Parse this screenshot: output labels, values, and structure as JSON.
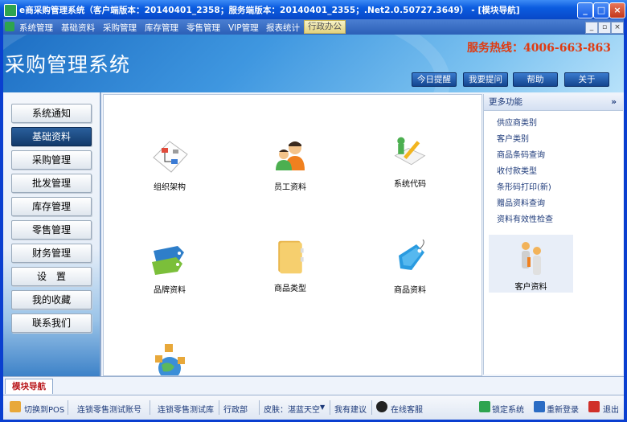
{
  "window": {
    "title": "e商采购管理系统（客户端版本：20140401_2358；服务端版本：20140401_2355；.Net2.0.50727.3649） - [模块导航]",
    "minimize": "_",
    "maximize": "□",
    "close": "×"
  },
  "menu": {
    "items": [
      "系统管理",
      "基础资料",
      "采购管理",
      "库存管理",
      "零售管理",
      "VIP管理",
      "报表统计",
      "行政办公"
    ],
    "mdi_minimize": "_",
    "mdi_restore": "▫",
    "mdi_close": "×"
  },
  "header": {
    "app_name": "采购管理系统",
    "hotline": "服务热线：4006-663-863",
    "buttons": [
      "今日提醒",
      "我要提问",
      "帮助",
      "关于"
    ]
  },
  "nav": {
    "items": [
      "系统通知",
      "基础资料",
      "采购管理",
      "批发管理",
      "库存管理",
      "零售管理",
      "财务管理",
      "设　置",
      "我的收藏",
      "联系我们"
    ],
    "active_index": 1
  },
  "modules": [
    {
      "label": "组织架构",
      "icon": "org-chart-icon"
    },
    {
      "label": "员工资料",
      "icon": "employees-icon"
    },
    {
      "label": "系统代码",
      "icon": "system-code-icon"
    },
    {
      "label": "品牌资料",
      "icon": "brand-tags-icon"
    },
    {
      "label": "商品类型",
      "icon": "folder-icon"
    },
    {
      "label": "商品资料",
      "icon": "product-tag-icon"
    },
    {
      "label": "",
      "icon": "globe-icon"
    }
  ],
  "more": {
    "title": "更多功能",
    "collapse": "»",
    "links": [
      "供应商类别",
      "客户类别",
      "商品条码查询",
      "收付款类型",
      "条形码打印(新)",
      "赠品资料查询",
      "资料有效性检查"
    ],
    "customer_tile": "客户资料"
  },
  "tab": {
    "label": "模块导航"
  },
  "status": {
    "pos": "切换到POS",
    "account": "连锁零售测试账号",
    "store": "连锁零售测试库",
    "dept": "行政部",
    "skin": "皮肤：湛蓝天空",
    "suggest": "我有建议",
    "online": "在线客服",
    "lock": "锁定系统",
    "relogin": "重新登录",
    "exit": "退出"
  },
  "colors": {
    "title_bar": "#0b5ce0",
    "hotline": "#e03a10",
    "active_nav": "#123a6b",
    "tab_label": "#b8161a"
  }
}
